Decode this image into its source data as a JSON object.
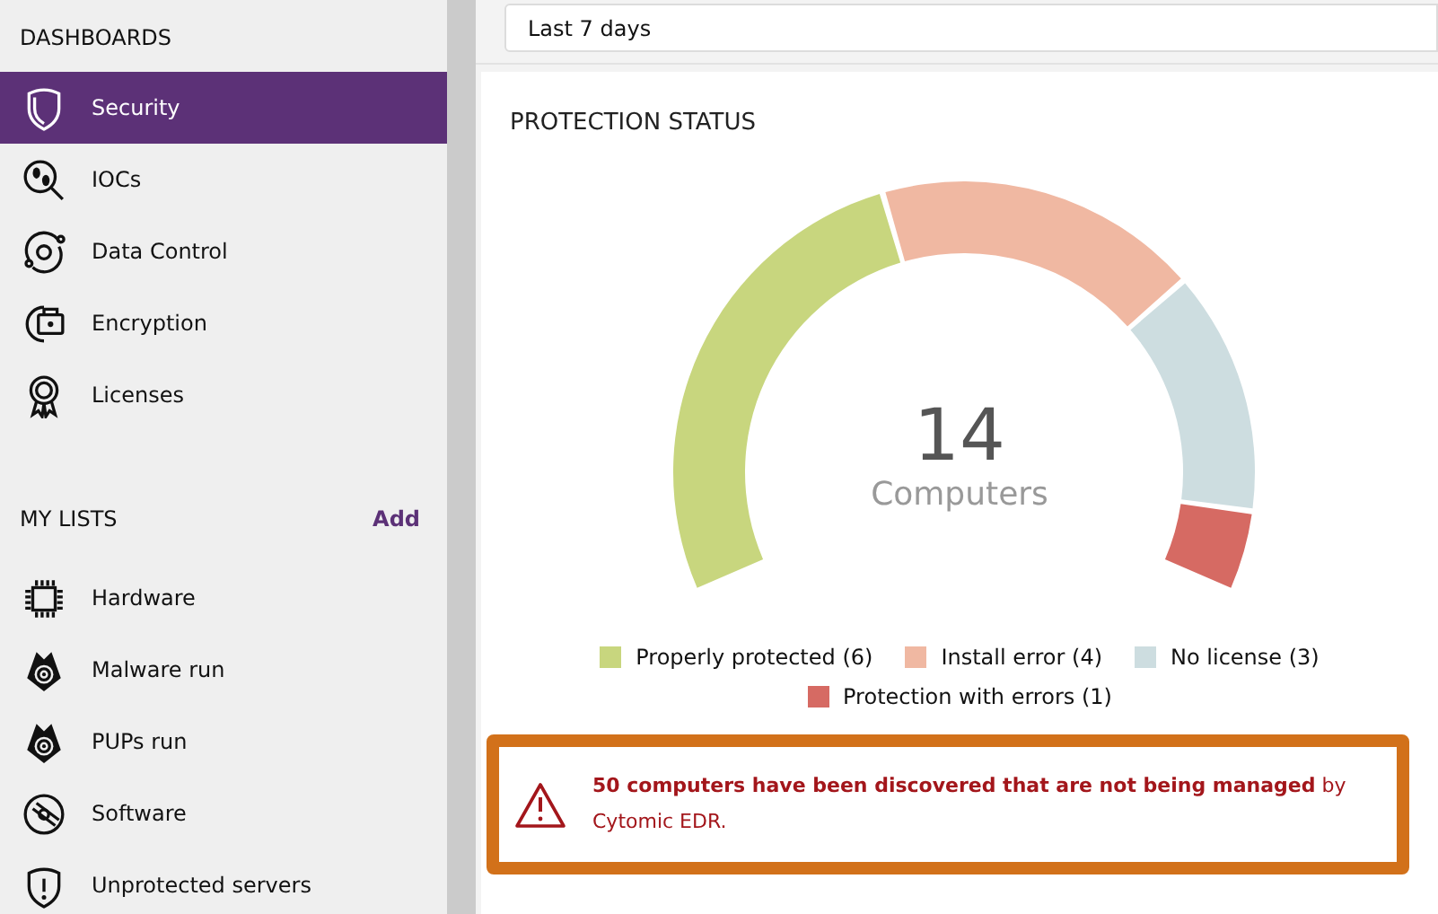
{
  "sidebar": {
    "dashboards_heading": "DASHBOARDS",
    "dashboards": [
      {
        "label": "Security",
        "selected": true
      },
      {
        "label": "IOCs",
        "selected": false
      },
      {
        "label": "Data Control",
        "selected": false
      },
      {
        "label": "Encryption",
        "selected": false
      },
      {
        "label": "Licenses",
        "selected": false
      }
    ],
    "lists_heading": "MY LISTS",
    "add_link": "Add",
    "lists": [
      {
        "label": "Hardware",
        "selected": false
      },
      {
        "label": "Malware run",
        "selected": false
      },
      {
        "label": "PUPs run",
        "selected": false
      },
      {
        "label": "Software",
        "selected": false
      },
      {
        "label": "Unprotected servers",
        "selected": false
      }
    ]
  },
  "date_range": {
    "value": "Last 7 days"
  },
  "protection_status": {
    "title": "PROTECTION STATUS",
    "total": "14",
    "chart_data": {
      "type": "donut",
      "categories": [
        "Properly protected (6)",
        "Install error (4)",
        "No license (3)",
        "Protection with errors (1)"
      ],
      "series": [
        {
          "name": "Computers",
          "values": [
            6,
            4,
            3,
            1
          ]
        }
      ]
    },
    "slices": [
      {
        "color": "#c8d67e"
      },
      {
        "color": "#f0b8a2"
      },
      {
        "color": "#cddde0"
      },
      {
        "color": "#d66a63"
      }
    ]
  },
  "alert": {
    "message": "**50 computers have been discovered that are not being managed** by Cytomic EDR."
  }
}
